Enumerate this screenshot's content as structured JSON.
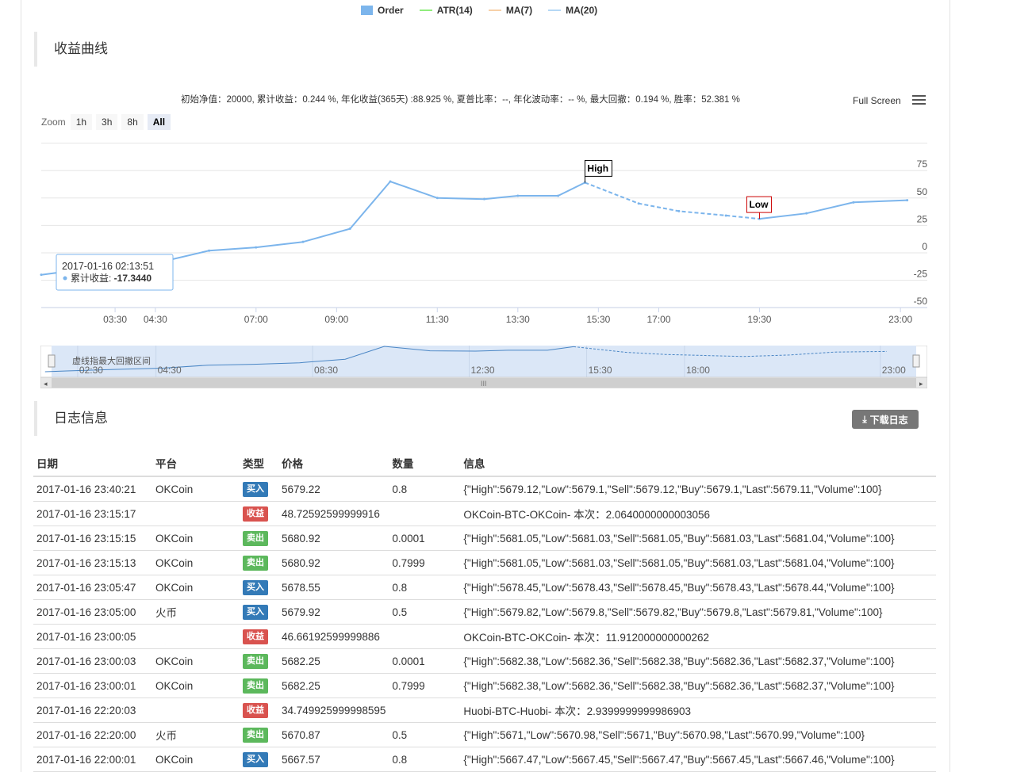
{
  "legend": [
    {
      "label": "Order",
      "color": "#7cb5ec",
      "kind": "box"
    },
    {
      "label": "ATR(14)",
      "color": "#90ed7d",
      "kind": "line"
    },
    {
      "label": "MA(7)",
      "color": "#f7d0a8",
      "kind": "line"
    },
    {
      "label": "MA(20)",
      "color": "#b5d8f5",
      "kind": "line"
    }
  ],
  "chart_section_title": "收益曲线",
  "summary_text": "初始净值：20000, 累计收益：0.244 %, 年化收益(365天) :88.925 %, 夏普比率：--, 年化波动率：-- %, 最大回撤：0.194 %, 胜率：52.381 %",
  "toolbar": {
    "fullscreen_label": "Full Screen",
    "menu_icon": "hamburger-icon"
  },
  "zoom": {
    "label": "Zoom",
    "buttons": [
      "1h",
      "3h",
      "8h",
      "All"
    ],
    "active": "All"
  },
  "tooltip": {
    "time": "2017-01-16 02:13:51",
    "series_label": "累计收益: ",
    "value": "-17.3440"
  },
  "flags": {
    "high": "High",
    "low": "Low"
  },
  "navigator": {
    "label": "虚线指最大回撤区间",
    "ticks": [
      "02:30",
      "04:30",
      "08:30",
      "12:30",
      "15:30",
      "18:00",
      "23:00"
    ]
  },
  "chart_data": {
    "type": "line",
    "series": [
      {
        "name": "累计收益",
        "x": [
          "01:40",
          "02:13",
          "03:30",
          "04:40",
          "05:50",
          "07:00",
          "08:10",
          "09:20",
          "10:20",
          "11:30",
          "12:40",
          "13:30",
          "14:30",
          "15:10",
          "16:30",
          "17:30",
          "18:40",
          "19:30",
          "20:40",
          "21:50",
          "23:10"
        ],
        "y": [
          -20,
          -17.344,
          -12,
          -8,
          2,
          5,
          10,
          22,
          65,
          50,
          49,
          52,
          52,
          64,
          45,
          38,
          34,
          31,
          36,
          46,
          48
        ]
      }
    ],
    "drawdown_segment": {
      "from": "15:10",
      "to": "19:30"
    },
    "high_point": {
      "x": "15:10",
      "y": 64
    },
    "low_point": {
      "x": "19:30",
      "y": 31
    },
    "x_ticks": [
      "03:30",
      "04:30",
      "07:00",
      "09:00",
      "11:30",
      "13:30",
      "15:30",
      "17:00",
      "19:30",
      "23:00"
    ],
    "y_ticks": [
      75,
      50,
      25,
      0,
      -25,
      -50
    ],
    "ylim": [
      -50,
      100
    ],
    "grid": true
  },
  "log_section_title": "日志信息",
  "download_label": "下载日志",
  "table": {
    "headers": [
      "日期",
      "平台",
      "类型",
      "价格",
      "数量",
      "信息"
    ],
    "rows": [
      {
        "date": "2017-01-16 23:40:21",
        "platform": "OKCoin",
        "type": "买入",
        "kind": "buy",
        "price": "5679.22",
        "qty": "0.8",
        "info": "{\"High\":5679.12,\"Low\":5679.1,\"Sell\":5679.12,\"Buy\":5679.1,\"Last\":5679.11,\"Volume\":100}"
      },
      {
        "date": "2017-01-16 23:15:17",
        "platform": "",
        "type": "收益",
        "kind": "profit",
        "price": "48.72592599999916",
        "qty": "",
        "info": "OKCoin-BTC-OKCoin- 本次：2.0640000000003056"
      },
      {
        "date": "2017-01-16 23:15:15",
        "platform": "OKCoin",
        "type": "卖出",
        "kind": "sell",
        "price": "5680.92",
        "qty": "0.0001",
        "info": "{\"High\":5681.05,\"Low\":5681.03,\"Sell\":5681.05,\"Buy\":5681.03,\"Last\":5681.04,\"Volume\":100}"
      },
      {
        "date": "2017-01-16 23:15:13",
        "platform": "OKCoin",
        "type": "卖出",
        "kind": "sell",
        "price": "5680.92",
        "qty": "0.7999",
        "info": "{\"High\":5681.05,\"Low\":5681.03,\"Sell\":5681.05,\"Buy\":5681.03,\"Last\":5681.04,\"Volume\":100}"
      },
      {
        "date": "2017-01-16 23:05:47",
        "platform": "OKCoin",
        "type": "买入",
        "kind": "buy",
        "price": "5678.55",
        "qty": "0.8",
        "info": "{\"High\":5678.45,\"Low\":5678.43,\"Sell\":5678.45,\"Buy\":5678.43,\"Last\":5678.44,\"Volume\":100}"
      },
      {
        "date": "2017-01-16 23:05:00",
        "platform": "火币",
        "type": "买入",
        "kind": "buy",
        "price": "5679.92",
        "qty": "0.5",
        "info": "{\"High\":5679.82,\"Low\":5679.8,\"Sell\":5679.82,\"Buy\":5679.8,\"Last\":5679.81,\"Volume\":100}"
      },
      {
        "date": "2017-01-16 23:00:05",
        "platform": "",
        "type": "收益",
        "kind": "profit",
        "price": "46.66192599999886",
        "qty": "",
        "info": "OKCoin-BTC-OKCoin- 本次：11.912000000000262"
      },
      {
        "date": "2017-01-16 23:00:03",
        "platform": "OKCoin",
        "type": "卖出",
        "kind": "sell",
        "price": "5682.25",
        "qty": "0.0001",
        "info": "{\"High\":5682.38,\"Low\":5682.36,\"Sell\":5682.38,\"Buy\":5682.36,\"Last\":5682.37,\"Volume\":100}"
      },
      {
        "date": "2017-01-16 23:00:01",
        "platform": "OKCoin",
        "type": "卖出",
        "kind": "sell",
        "price": "5682.25",
        "qty": "0.7999",
        "info": "{\"High\":5682.38,\"Low\":5682.36,\"Sell\":5682.38,\"Buy\":5682.36,\"Last\":5682.37,\"Volume\":100}"
      },
      {
        "date": "2017-01-16 22:20:03",
        "platform": "",
        "type": "收益",
        "kind": "profit",
        "price": "34.749925999998595",
        "qty": "",
        "info": "Huobi-BTC-Huobi- 本次：2.9399999999986903"
      },
      {
        "date": "2017-01-16 22:20:00",
        "platform": "火币",
        "type": "卖出",
        "kind": "sell",
        "price": "5670.87",
        "qty": "0.5",
        "info": "{\"High\":5671,\"Low\":5670.98,\"Sell\":5671,\"Buy\":5670.98,\"Last\":5670.99,\"Volume\":100}"
      },
      {
        "date": "2017-01-16 22:00:01",
        "platform": "OKCoin",
        "type": "买入",
        "kind": "buy",
        "price": "5667.57",
        "qty": "0.8",
        "info": "{\"High\":5667.47,\"Low\":5667.45,\"Sell\":5667.47,\"Buy\":5667.45,\"Last\":5667.46,\"Volume\":100}"
      }
    ]
  }
}
